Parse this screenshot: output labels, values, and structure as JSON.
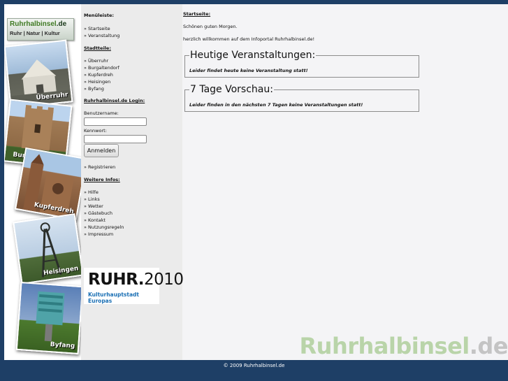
{
  "logo": {
    "name": "Ruhrhalbinsel",
    "domain": ".de",
    "tagline": "Ruhr | Natur | Kultur"
  },
  "photos": [
    {
      "caption": "Überruhr"
    },
    {
      "caption": "Burgaltendorf"
    },
    {
      "caption": "Kupferdreh"
    },
    {
      "caption": "Heisingen"
    },
    {
      "caption": "Byfang"
    }
  ],
  "sidebar": {
    "menu_heading": "Menüleiste:",
    "menu_items": [
      "» Startseite",
      "» Veranstaltung"
    ],
    "districts_heading": "Stadtteile:",
    "districts": [
      "» Überruhr",
      "» Burgaltendorf",
      "» Kupferdreh",
      "» Heisingen",
      "» Byfang"
    ],
    "login_heading": "Ruhrhalbinsel.de Login:",
    "username_label": "Benutzername:",
    "password_label": "Kennwort:",
    "login_button": "Anmelden",
    "register_link": "» Registrieren",
    "info_heading": "Weitere Infos:",
    "info_items": [
      "» Hilfe",
      "» Links",
      "» Wetter",
      "» Gästebuch",
      "» Kontakt",
      "» Nutzungsregeln",
      "» Impressum"
    ]
  },
  "ruhr2010": {
    "big_a": "RUHR.",
    "big_b": "2010",
    "sub": "Kulturhauptstadt Europas"
  },
  "main": {
    "heading": "Startseite:",
    "greeting": "Schönen guten Morgen.",
    "welcome": "herzlich willkommen auf dem Infoportal Ruhrhalbinsel.de!",
    "today": {
      "title": "Heutige Veranstaltungen:",
      "message": "Leider findet heute keine Veranstaltung statt!"
    },
    "week": {
      "title": "7 Tage Vorschau:",
      "message": "Leider finden in den nächsten 7 Tagen keine Veranstaltungen statt!"
    }
  },
  "watermark": {
    "name": "Ruhrhalbinsel",
    "tld": ".de"
  },
  "footer": "© 2009 Ruhrhalbinsel.de",
  "colors": {
    "background": "#1e3f66",
    "accent_green": "#3f7a23",
    "ruhr_blue": "#1a6fb4"
  }
}
